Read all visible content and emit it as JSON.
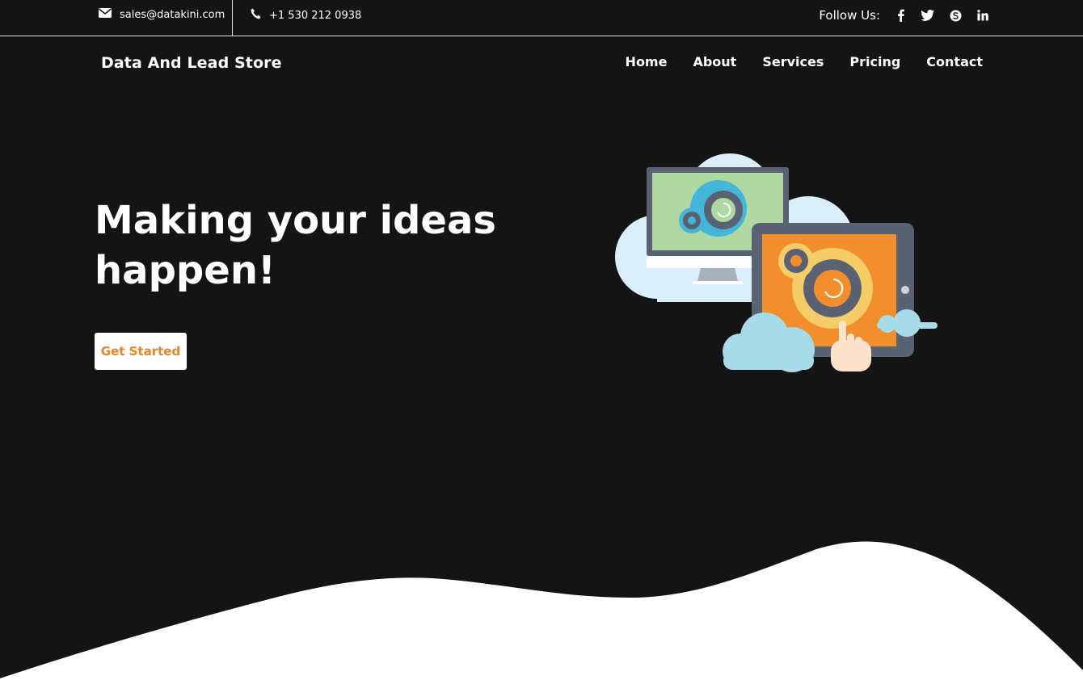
{
  "topbar": {
    "email": "sales@datakini.com",
    "phone": "+1 530 212 0938",
    "follow_label": "Follow Us:",
    "social_icons": [
      "facebook-icon",
      "twitter-icon",
      "skype-icon",
      "linkedin-icon"
    ]
  },
  "navbar": {
    "brand": "Data And Lead Store",
    "menu": [
      "Home",
      "About",
      "Services",
      "Pricing",
      "Contact"
    ]
  },
  "hero": {
    "title_line1": "Making your ideas",
    "title_line2": "happen!",
    "cta_label": "Get Started",
    "illustration": "computer-tablet-gears-cloud-illustration"
  },
  "colors": {
    "background": "#141414",
    "text": "#ffffff",
    "accent": "#e6852a",
    "wave": "#ffffff"
  }
}
